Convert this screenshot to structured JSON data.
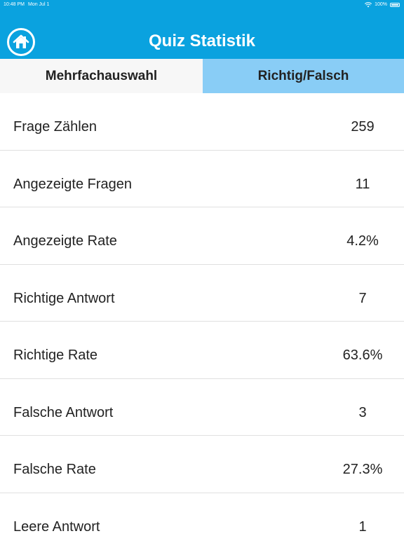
{
  "status_bar": {
    "time": "10:48 PM",
    "date": "Mon Jul 1",
    "battery": "100%"
  },
  "header": {
    "title": "Quiz Statistik",
    "home_icon": "home-icon"
  },
  "tabs": [
    {
      "label": "Mehrfachauswahl",
      "selected": false
    },
    {
      "label": "Richtig/Falsch",
      "selected": true
    }
  ],
  "stats": [
    {
      "label": "Frage Zählen",
      "value": "259"
    },
    {
      "label": "Angezeigte Fragen",
      "value": "11"
    },
    {
      "label": "Angezeigte Rate",
      "value": "4.2%"
    },
    {
      "label": "Richtige Antwort",
      "value": "7"
    },
    {
      "label": "Richtige Rate",
      "value": "63.6%"
    },
    {
      "label": "Falsche Antwort",
      "value": "3"
    },
    {
      "label": "Falsche Rate",
      "value": "27.3%"
    },
    {
      "label": "Leere Antwort",
      "value": "1"
    }
  ],
  "colors": {
    "header_bg": "#0aa2df",
    "selected_tab_bg": "#89cdf6",
    "unselected_tab_bg": "#f7f7f7"
  }
}
